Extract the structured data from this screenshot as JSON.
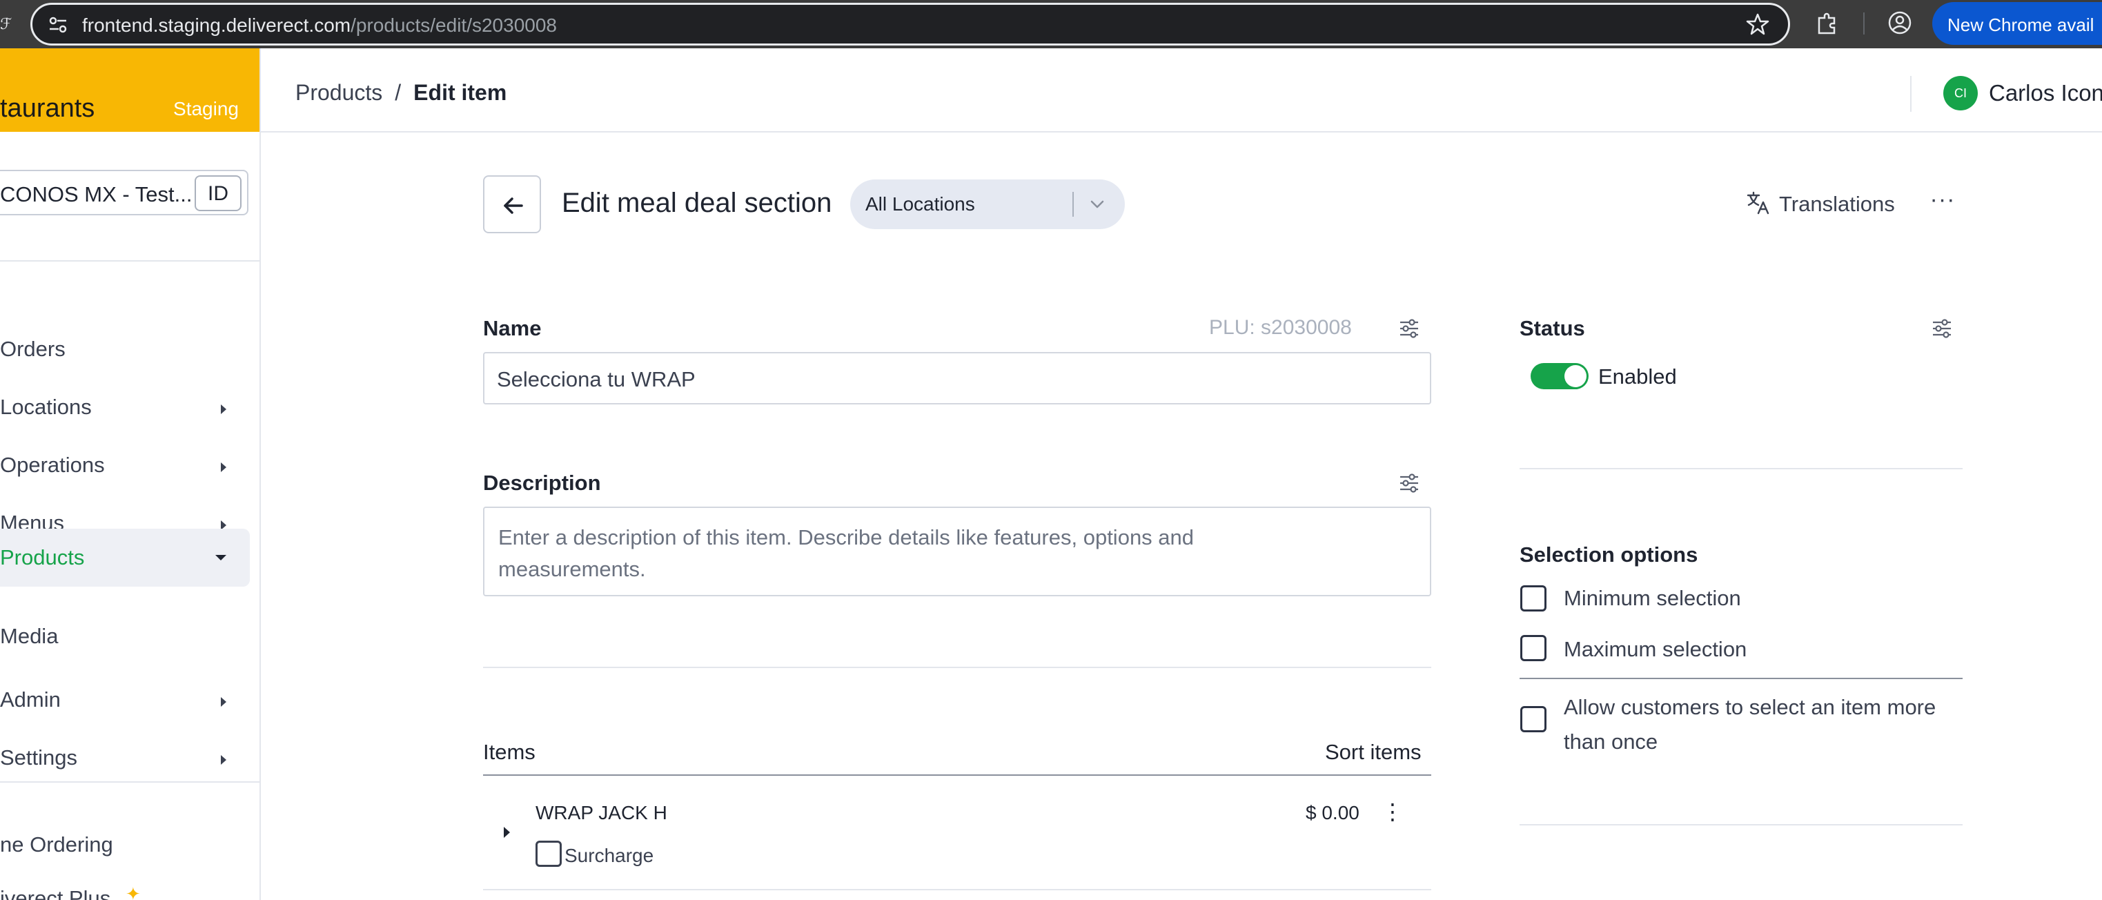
{
  "browser": {
    "url_host": "frontend.staging.deliverect.com",
    "url_path": "/products/edit/s2030008",
    "new_chrome_label": "New Chrome avail"
  },
  "sidebar": {
    "brand_name": "taurants",
    "env_badge": "Staging",
    "account_name": "CONOS MX - Test...",
    "account_id": "ID",
    "items": [
      {
        "label": "Orders",
        "has_caret": false
      },
      {
        "label": "Locations",
        "has_caret": true
      },
      {
        "label": "Operations",
        "has_caret": true
      },
      {
        "label": "Menus",
        "has_caret": true
      },
      {
        "label": "Products",
        "has_caret": true,
        "active": true
      },
      {
        "label": "Media",
        "has_caret": false
      },
      {
        "label": "Admin",
        "has_caret": true
      },
      {
        "label": "Settings",
        "has_caret": true
      }
    ],
    "bottom_items": [
      {
        "label": "ne Ordering"
      },
      {
        "label": "iverect Plus"
      }
    ]
  },
  "header": {
    "breadcrumb_parent": "Products",
    "breadcrumb_separator": "/",
    "breadcrumb_current": "Edit item",
    "user_initials": "CI",
    "user_name": "Carlos Icon"
  },
  "page": {
    "title": "Edit meal deal section",
    "location_select": "All Locations",
    "translations_label": "Translations",
    "more_label": "···"
  },
  "form": {
    "name_label": "Name",
    "plu_text": "PLU: s2030008",
    "name_value": "Selecciona tu WRAP",
    "description_label": "Description",
    "description_placeholder": "Enter a description of this item. Describe details like features, options and measurements."
  },
  "items": {
    "header": "Items",
    "sort_label": "Sort items",
    "rows": [
      {
        "name": "WRAP JACK H",
        "price": "$ 0.00",
        "surcharge_label": "Surcharge",
        "surcharge_checked": false
      }
    ]
  },
  "status": {
    "label": "Status",
    "toggle_label": "Enabled",
    "enabled": true
  },
  "selection_options": {
    "label": "Selection options",
    "options": [
      {
        "label": "Minimum selection",
        "checked": false
      },
      {
        "label": "Maximum selection",
        "checked": false
      },
      {
        "label": "Allow customers to select an item more than once",
        "checked": false
      }
    ]
  },
  "colors": {
    "brand": "#f8b704",
    "accent_green": "#16a34a",
    "chrome_blue": "#0b57d0"
  }
}
